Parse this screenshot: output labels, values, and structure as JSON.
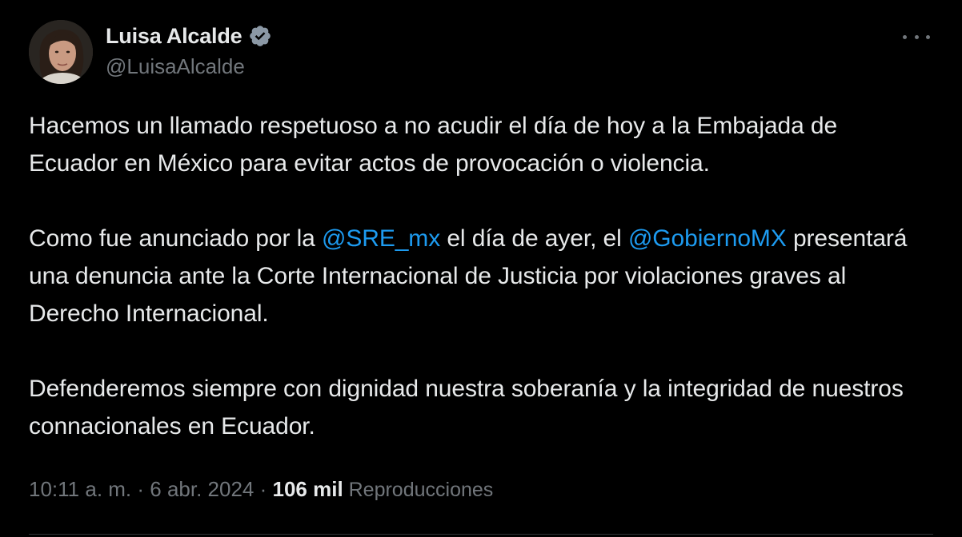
{
  "author": {
    "display_name": "Luisa Alcalde",
    "handle": "@LuisaAlcalde",
    "verified_icon": "verified-badge-icon"
  },
  "tweet": {
    "para1": "Hacemos un llamado respetuoso a no acudir el día de hoy a la Embajada de Ecuador en México para evitar actos de provocación o violencia.",
    "para2_before": "Como fue anunciado por la ",
    "para2_mention1": "@SRE_mx",
    "para2_middle": " el día de ayer, el ",
    "para2_mention2": "@GobiernoMX",
    "para2_after": " presentará  una denuncia ante la Corte Internacional de Justicia por violaciones graves al Derecho Internacional.",
    "para3": "Defenderemos siempre con dignidad nuestra soberanía y la integridad de nuestros connacionales en Ecuador."
  },
  "meta": {
    "time": "10:11 a. m.",
    "sep1": " · ",
    "date": "6 abr. 2024",
    "sep2": " · ",
    "views_count": "106 mil",
    "views_label": " Reproducciones"
  },
  "colors": {
    "background": "#000000",
    "text": "#e7e9ea",
    "secondary": "#71767b",
    "link": "#1d9bf0",
    "verified": "#8b98a5"
  }
}
